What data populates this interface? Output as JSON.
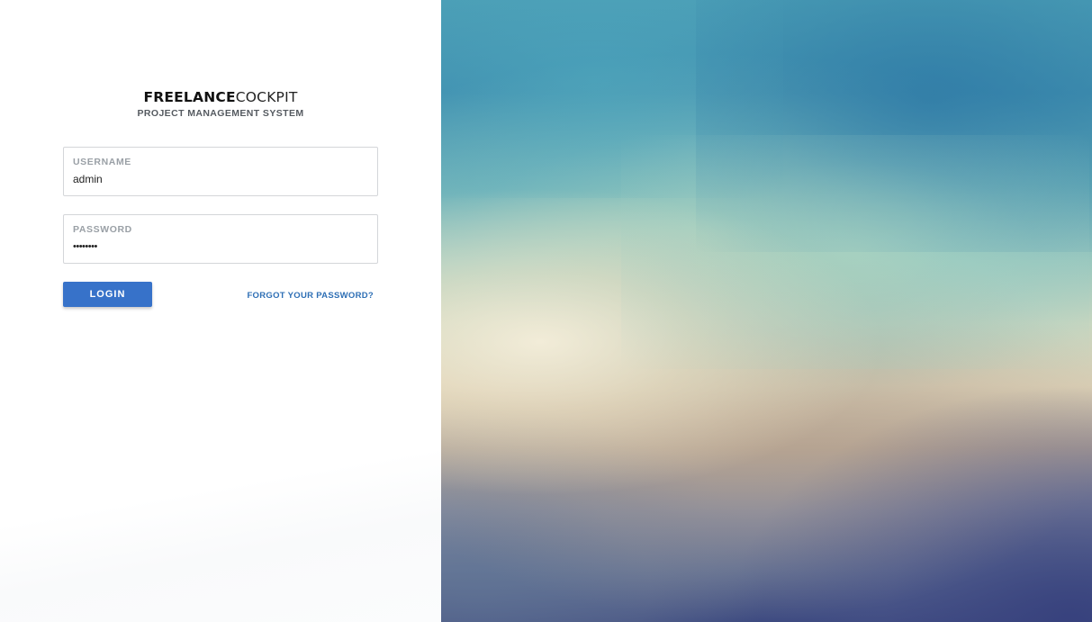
{
  "brand": {
    "logo_bold": "FREELANCE",
    "logo_light": "COCKPIT",
    "subtitle": "PROJECT MANAGEMENT SYSTEM"
  },
  "login_form": {
    "username": {
      "label": "USERNAME",
      "value": "admin"
    },
    "password": {
      "label": "PASSWORD",
      "value": "••••••••"
    },
    "login_label": "LOGIN",
    "forgot_label": "FORGOT YOUR PASSWORD?"
  },
  "colors": {
    "accent": "#3772c9",
    "link": "#2e6fb5",
    "label": "#9aa0a6"
  }
}
